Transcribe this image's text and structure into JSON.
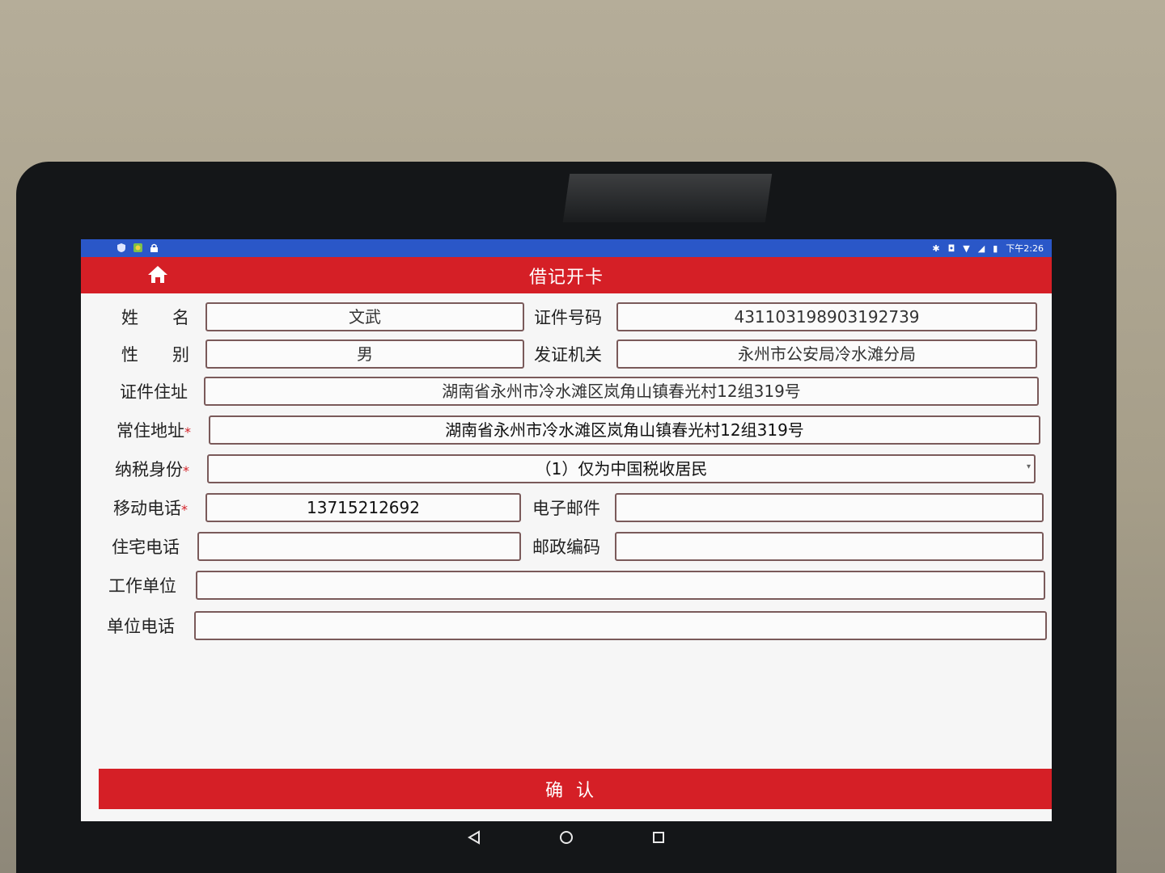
{
  "status_bar": {
    "time": "下午2:26",
    "left_icons": [
      "shield-icon",
      "app-icon",
      "lock-icon"
    ],
    "right_icons": [
      "bluetooth-icon",
      "vibrate-icon",
      "wifi-icon",
      "signal-icon",
      "battery-icon"
    ]
  },
  "header": {
    "title": "借记开卡",
    "home_icon": "home-icon"
  },
  "form": {
    "name": {
      "label": "姓　　名",
      "value": "文武"
    },
    "id_number": {
      "label": "证件号码",
      "value": "431103198903192739"
    },
    "gender": {
      "label": "性　　别",
      "value": "男"
    },
    "issuing_authority": {
      "label": "发证机关",
      "value": "永州市公安局冷水滩分局"
    },
    "id_address": {
      "label": "证件住址",
      "value": "湖南省永州市冷水滩区岚角山镇春光村12组319号"
    },
    "residential_address": {
      "label": "常住地址",
      "required_mark": "*",
      "value": "湖南省永州市冷水滩区岚角山镇春光村12组319号"
    },
    "tax_status": {
      "label": "纳税身份",
      "required_mark": "*",
      "value": "（1）仅为中国税收居民"
    },
    "mobile": {
      "label": "移动电话",
      "required_mark": "*",
      "value": "13715212692"
    },
    "email": {
      "label": "电子邮件",
      "value": ""
    },
    "home_phone": {
      "label": "住宅电话",
      "value": ""
    },
    "postal_code": {
      "label": "邮政编码",
      "value": ""
    },
    "employer": {
      "label": "工作单位",
      "value": ""
    },
    "employer_phone": {
      "label": "单位电话",
      "value": ""
    }
  },
  "actions": {
    "confirm_label": "确认"
  },
  "nav": {
    "back_icon": "back-triangle-icon",
    "home_icon": "home-circle-icon",
    "recents_icon": "recents-square-icon"
  },
  "colors": {
    "brand_red": "#d51f26",
    "status_blue": "#2a57c8"
  }
}
